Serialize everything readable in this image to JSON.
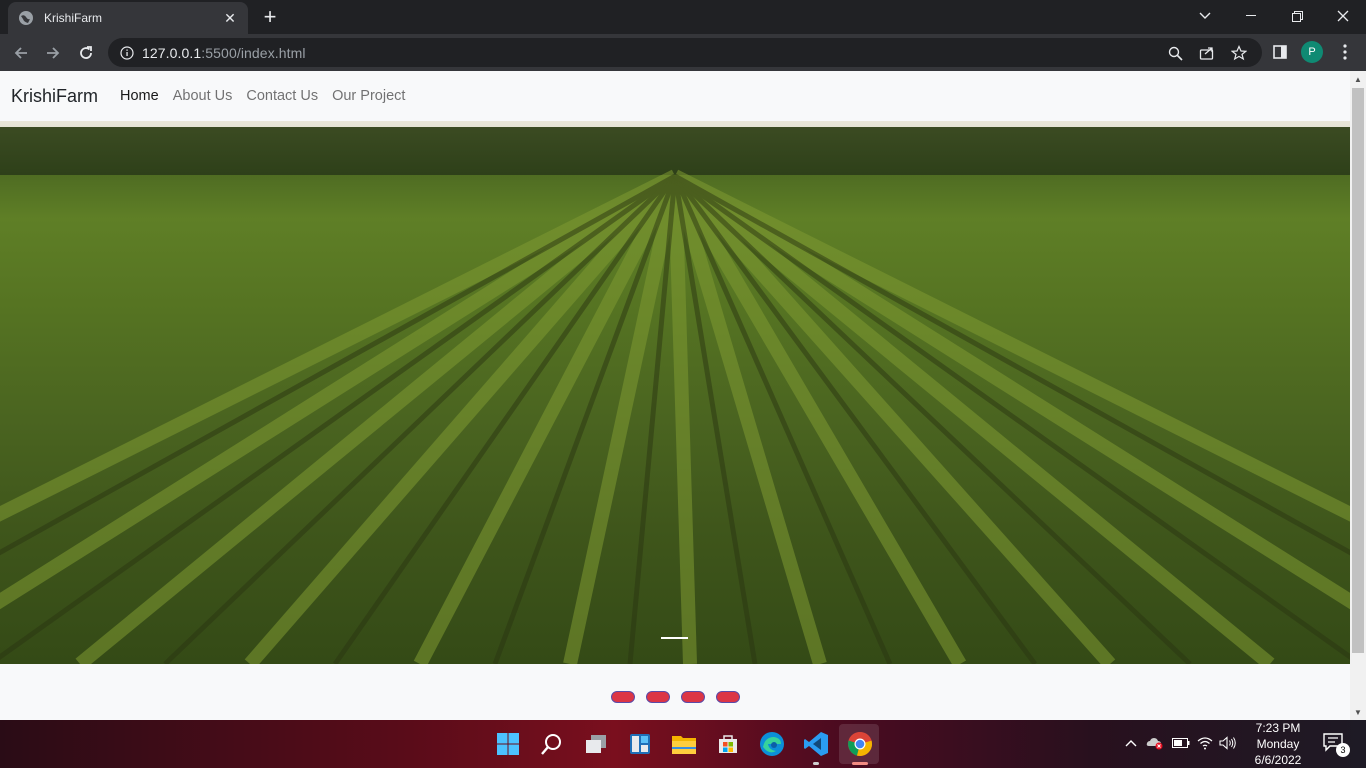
{
  "browser": {
    "tab_title": "KrishiFarm",
    "tab_close": "✕",
    "new_tab": "+",
    "url_host": "127.0.0.1",
    "url_rest": ":5500/index.html",
    "profile_initial": "P"
  },
  "site": {
    "brand": "KrishiFarm",
    "nav": [
      {
        "label": "Home",
        "active": true
      },
      {
        "label": "About Us",
        "active": false
      },
      {
        "label": "Contact Us",
        "active": false
      },
      {
        "label": "Our Project",
        "active": false
      }
    ],
    "carousel_slides": 4
  },
  "taskbar": {
    "apps": [
      "start-icon",
      "search-icon",
      "task-view-icon",
      "widgets-icon",
      "file-explorer-icon",
      "store-icon",
      "edge-icon",
      "vscode-icon",
      "chrome-icon"
    ],
    "clock_time": "7:23 PM",
    "clock_day": "Monday",
    "clock_date": "6/6/2022",
    "notification_count": "3"
  },
  "colors": {
    "carousel_dot": "#dc3545",
    "avatar": "#0f8a73"
  }
}
